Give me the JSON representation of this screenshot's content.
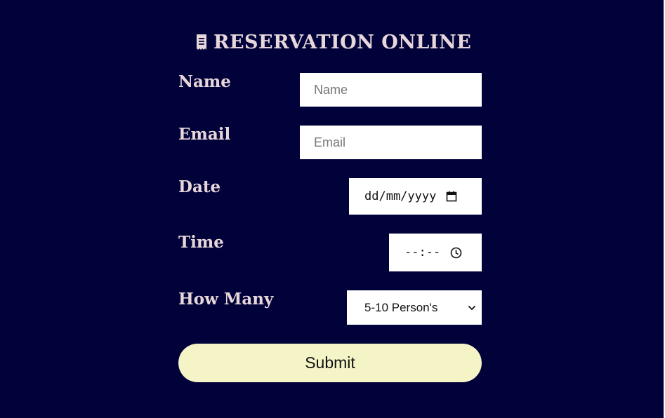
{
  "page": {
    "title": "RESERVATION ONLINE",
    "title_icon": "receipt-icon",
    "colors": {
      "background": "#02023a",
      "label_text": "#e8d7da",
      "submit_bg": "#f5f4c6"
    }
  },
  "form": {
    "name": {
      "label": "Name",
      "placeholder": "Name",
      "value": ""
    },
    "email": {
      "label": "Email",
      "placeholder": "Email",
      "value": ""
    },
    "date": {
      "label": "Date",
      "placeholder": "dd/mm/yyyy",
      "icon": "calendar-icon"
    },
    "time": {
      "label": "Time",
      "placeholder": "--:--",
      "icon": "clock-icon"
    },
    "how_many": {
      "label": "How Many",
      "selected": "5-10 Person's",
      "icon": "chevron-down-icon"
    },
    "submit_label": "Submit"
  }
}
